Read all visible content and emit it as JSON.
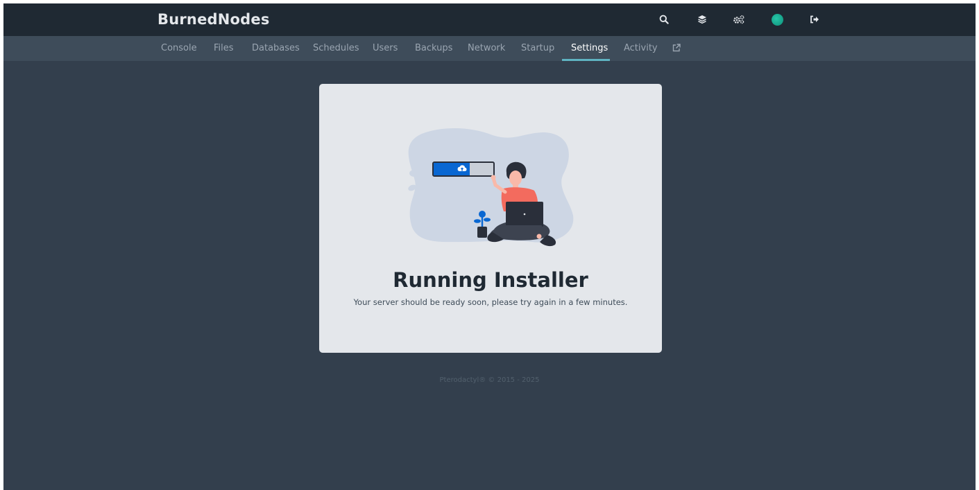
{
  "header": {
    "brand": "BurnedNodes",
    "icons": [
      "search-icon",
      "layers-icon",
      "cogs-icon",
      "avatar",
      "sign-out-icon"
    ]
  },
  "nav": {
    "tabs": [
      {
        "label": "Console"
      },
      {
        "label": "Files"
      },
      {
        "label": "Databases"
      },
      {
        "label": "Schedules"
      },
      {
        "label": "Users"
      },
      {
        "label": "Backups"
      },
      {
        "label": "Network"
      },
      {
        "label": "Startup"
      },
      {
        "label": "Settings",
        "active": true
      },
      {
        "label": "Activity"
      }
    ],
    "external_icon": "external-link-icon"
  },
  "main": {
    "title": "Running Installer",
    "message": "Your server should be ready soon, please try again in a few minutes."
  },
  "footer": {
    "text": "Pterodactyl® © 2015 - 2025"
  },
  "colors": {
    "topbar": "#1f2933",
    "subnav": "#3e4c5a",
    "background": "#333f4d",
    "card": "#e4e7eb",
    "accent": "#5fb3c2",
    "progress_blue": "#0967d2"
  }
}
